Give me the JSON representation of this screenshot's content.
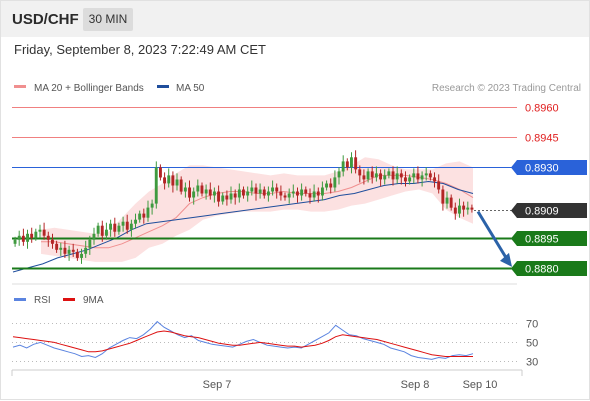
{
  "header": {
    "symbol": "USD/CHF",
    "timeframe": "30 MIN",
    "datetime": "Friday, September 8, 2023 7:22:49 AM CET"
  },
  "colors": {
    "background": "#ffffff",
    "header_bg": "#f1f1f1",
    "bull_candle": "#3f9a3f",
    "bear_candle": "#b32525",
    "bollinger_fill": "#fbdcdc",
    "ma20": "#f08f8f",
    "ma50": "#1f4e9c",
    "resistance": "#f08080",
    "pivot": "#2a62d9",
    "support": "#1a7a1a",
    "last_price": "#333333",
    "arrow": "#2b62a8",
    "rsi": "#5b84e0",
    "rsi_ma": "#dd1111"
  },
  "chart_data": [
    {
      "type": "candlestick",
      "legend": {
        "placement": "top-left",
        "items": [
          {
            "label": "MA 20 + Bollinger Bands",
            "color": "#f08f8f"
          },
          {
            "label": "MA 50",
            "color": "#1f4e9c"
          }
        ]
      },
      "credit": "Research © 2023 Trading Central",
      "ylim": [
        0.8875,
        0.8965
      ],
      "x_ticks": [
        "Sep 7",
        "Sep 8",
        "Sep 10"
      ],
      "levels": [
        {
          "value": 0.896,
          "label": "0.8960",
          "kind": "resistance"
        },
        {
          "value": 0.8945,
          "label": "0.8945",
          "kind": "resistance"
        },
        {
          "value": 0.893,
          "label": "0.8930",
          "kind": "pivot"
        },
        {
          "value": 0.8909,
          "label": "0.8909",
          "kind": "last"
        },
        {
          "value": 0.8895,
          "label": "0.8895",
          "kind": "support"
        },
        {
          "value": 0.888,
          "label": "0.8880",
          "kind": "support"
        }
      ],
      "forecast": {
        "direction": "down",
        "target": 0.888
      },
      "closes": [
        0.8894,
        0.8896,
        0.8893,
        0.8897,
        0.8895,
        0.8898,
        0.8899,
        0.8896,
        0.8894,
        0.8892,
        0.8889,
        0.889,
        0.8887,
        0.8889,
        0.8888,
        0.8885,
        0.8887,
        0.889,
        0.8894,
        0.8897,
        0.8901,
        0.8896,
        0.8899,
        0.8902,
        0.8898,
        0.8901,
        0.8903,
        0.8899,
        0.8902,
        0.8904,
        0.8907,
        0.8905,
        0.891,
        0.8912,
        0.893,
        0.8925,
        0.8922,
        0.8926,
        0.8921,
        0.8924,
        0.8918,
        0.892,
        0.8915,
        0.8918,
        0.8921,
        0.8917,
        0.8919,
        0.8916,
        0.8918,
        0.8913,
        0.8916,
        0.8914,
        0.8917,
        0.8915,
        0.8919,
        0.8916,
        0.8918,
        0.892,
        0.8917,
        0.8919,
        0.8916,
        0.8918,
        0.892,
        0.8918,
        0.8916,
        0.8915,
        0.8917,
        0.8918,
        0.8916,
        0.8919,
        0.8917,
        0.8915,
        0.8918,
        0.8916,
        0.892,
        0.8922,
        0.892,
        0.8925,
        0.8928,
        0.8933,
        0.893,
        0.8935,
        0.8929,
        0.8926,
        0.8924,
        0.8928,
        0.8925,
        0.8927,
        0.8924,
        0.8926,
        0.8928,
        0.8924,
        0.8927,
        0.8925,
        0.8923,
        0.8925,
        0.8927,
        0.8924,
        0.8926,
        0.8927,
        0.8925,
        0.8923,
        0.8919,
        0.8912,
        0.8915,
        0.891,
        0.8907,
        0.8911,
        0.8909,
        0.891,
        0.8909
      ],
      "ma50": [
        0.8878,
        0.888,
        0.8882,
        0.8885,
        0.8887,
        0.8889,
        0.8892,
        0.8895,
        0.8899,
        0.8902,
        0.8903,
        0.8904,
        0.8905,
        0.8906,
        0.8907,
        0.8908,
        0.8909,
        0.891,
        0.8911,
        0.8912,
        0.8913,
        0.8914,
        0.8916,
        0.8917,
        0.8919,
        0.8921,
        0.8922,
        0.8922,
        0.8923,
        0.8922,
        0.8919,
        0.8917
      ],
      "ma20": [
        0.8893,
        0.8893,
        0.8892,
        0.8891,
        0.889,
        0.889,
        0.8892,
        0.8895,
        0.8898,
        0.8901,
        0.8905,
        0.8912,
        0.8915,
        0.8917,
        0.8918,
        0.8918,
        0.8917,
        0.8917,
        0.8918,
        0.8917,
        0.8917,
        0.8917,
        0.8918,
        0.892,
        0.8923,
        0.8926,
        0.8926,
        0.8926,
        0.8925,
        0.8924,
        0.8922,
        0.8919,
        0.8915
      ],
      "bb_upper": [
        0.8899,
        0.89,
        0.8899,
        0.8898,
        0.8897,
        0.8898,
        0.8905,
        0.8912,
        0.8918,
        0.8922,
        0.8927,
        0.8931,
        0.8931,
        0.893,
        0.8929,
        0.8928,
        0.8927,
        0.8926,
        0.8927,
        0.8926,
        0.8926,
        0.8926,
        0.8928,
        0.8931,
        0.8935,
        0.8934,
        0.8931,
        0.8929,
        0.8929,
        0.8929,
        0.8932,
        0.8933,
        0.893
      ],
      "bb_lower": [
        0.8887,
        0.8886,
        0.8885,
        0.8884,
        0.8883,
        0.8883,
        0.8883,
        0.8885,
        0.889,
        0.8892,
        0.8896,
        0.8899,
        0.8904,
        0.8906,
        0.8907,
        0.8908,
        0.8908,
        0.8908,
        0.8909,
        0.8909,
        0.8908,
        0.8908,
        0.8909,
        0.8911,
        0.8912,
        0.8914,
        0.8916,
        0.8918,
        0.8919,
        0.8917,
        0.8909,
        0.8905,
        0.8902
      ]
    },
    {
      "type": "line",
      "legend": {
        "placement": "top-left",
        "items": [
          {
            "label": "RSI",
            "color": "#5b84e0"
          },
          {
            "label": "9MA",
            "color": "#dd1111"
          }
        ]
      },
      "ylim": [
        25,
        80
      ],
      "y_ticks": [
        "70",
        "50",
        "30"
      ],
      "series": [
        {
          "name": "RSI",
          "values": [
            45,
            47,
            44,
            48,
            50,
            47,
            44,
            42,
            40,
            38,
            35,
            36,
            34,
            38,
            44,
            48,
            52,
            55,
            54,
            58,
            64,
            72,
            66,
            62,
            58,
            55,
            57,
            52,
            50,
            48,
            47,
            46,
            45,
            48,
            51,
            53,
            50,
            47,
            46,
            45,
            44,
            45,
            44,
            48,
            52,
            56,
            60,
            68,
            63,
            58,
            57,
            54,
            52,
            50,
            48,
            44,
            42,
            40,
            36,
            34,
            33,
            32,
            34,
            33,
            36,
            37,
            36,
            38
          ]
        },
        {
          "name": "9MA",
          "values": [
            56,
            55,
            54,
            53,
            52,
            51,
            50,
            48,
            46,
            44,
            42,
            40,
            40,
            41,
            43,
            45,
            47,
            49,
            52,
            55,
            58,
            61,
            62,
            61,
            59,
            57,
            56,
            55,
            53,
            51,
            49,
            48,
            47,
            47,
            48,
            49,
            50,
            49,
            48,
            47,
            46,
            46,
            45,
            46,
            47,
            49,
            52,
            56,
            58,
            57,
            56,
            55,
            54,
            53,
            51,
            49,
            47,
            45,
            43,
            41,
            39,
            37,
            36,
            35,
            35,
            35,
            35,
            35
          ]
        }
      ]
    }
  ]
}
